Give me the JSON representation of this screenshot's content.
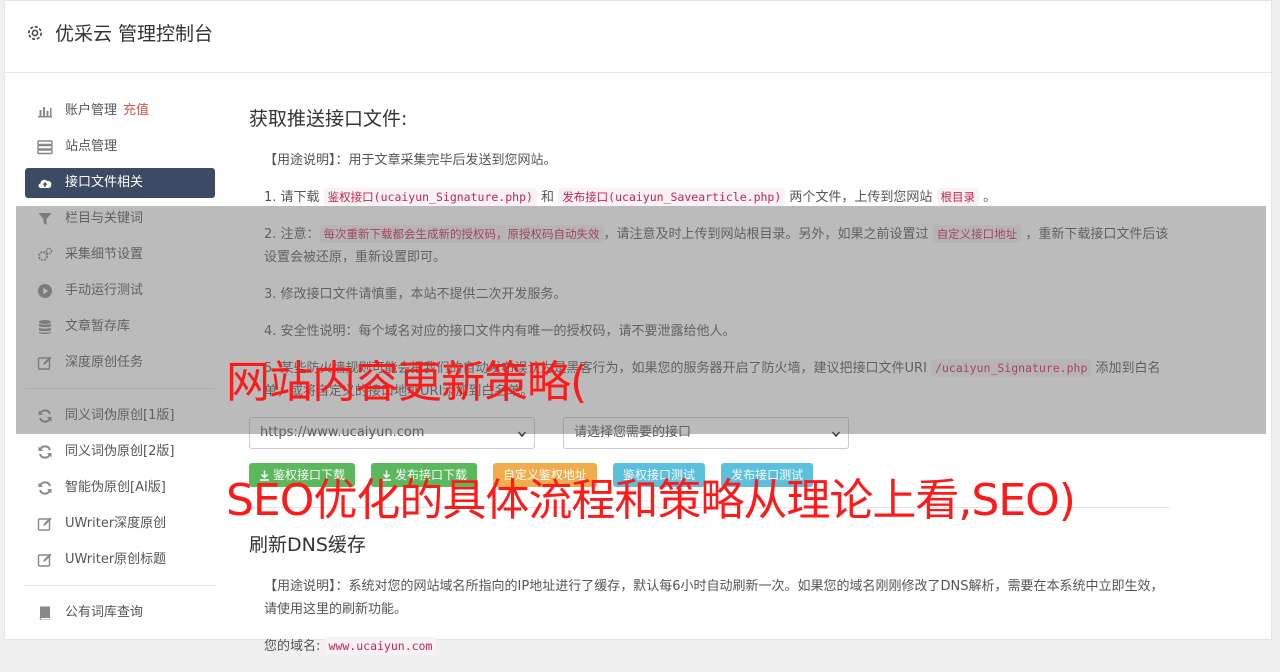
{
  "app": {
    "title": "优采云 管理控制台"
  },
  "sidebar": {
    "items": [
      {
        "label": "账户管理",
        "badge": "充值",
        "icon": "bar-chart-icon"
      },
      {
        "label": "站点管理",
        "icon": "server-icon"
      },
      {
        "label": "接口文件相关",
        "icon": "cloud-upload-icon",
        "active": true
      },
      {
        "label": "栏目与关键词",
        "icon": "filter-icon"
      },
      {
        "label": "采集细节设置",
        "icon": "cogs-icon"
      },
      {
        "label": "手动运行测试",
        "icon": "play-circle-icon"
      },
      {
        "label": "文章暂存库",
        "icon": "database-icon"
      },
      {
        "label": "深度原创任务",
        "icon": "edit-icon"
      }
    ],
    "items2": [
      {
        "label": "同义词伪原创[1版]",
        "icon": "refresh-icon"
      },
      {
        "label": "同义词伪原创[2版]",
        "icon": "refresh-icon"
      },
      {
        "label": "智能伪原创[AI版]",
        "icon": "refresh-icon"
      },
      {
        "label": "UWriter深度原创",
        "icon": "edit-icon"
      },
      {
        "label": "UWriter原创标题",
        "icon": "edit-icon"
      }
    ],
    "items3": [
      {
        "label": "公有词库查询",
        "icon": "book-icon"
      }
    ]
  },
  "section1": {
    "title": "获取推送接口文件:",
    "usage_label": "【用途说明】",
    "usage_text": "：用于文章采集完毕后发送到您网站。",
    "p1_a": "1. 请下载 ",
    "p1_code1": "鉴权接口(ucaiyun_Signature.php)",
    "p1_b": " 和 ",
    "p1_code2": "发布接口(ucaiyun_Savearticle.php)",
    "p1_c": " 两个文件，上传到您网站 ",
    "p1_code3": "根目录",
    "p1_d": " 。",
    "p2_a": "2. 注意：",
    "p2_code1": "每次重新下载都会生成新的授权码，原授权码自动失效",
    "p2_b": "，请注意及时上传到网站根目录。另外，如果之前设置过 ",
    "p2_code2": "自定义接口地址",
    "p2_c": " ，重新下载接口文件后该设置会被还原，重新设置即可。",
    "p3": "3. 修改接口文件请慎重，本站不提供二次开发服务。",
    "p4": "4. 安全性说明：每个域名对应的接口文件内有唯一的授权码，请不要泄露给他人。",
    "p5_a": "5. 某些防火墙规则可能会把我们的自动发布误认为是黑客行为，如果您的服务器开启了防火墙，建议把接口文件URI ",
    "p5_code1": "/ucaiyun_Signature.php",
    "p5_b": " 添加到白名单，",
    "p5_c": "或将自定义的接口地址URI添加到白名单。",
    "site_select": "https://www.ucaiyun.com",
    "api_select": "请选择您需要的接口",
    "buttons": {
      "download_sign": "鉴权接口下载",
      "download_publish": "发布接口下载",
      "custom_sign": "自定义鉴权地址",
      "test_sign": "鉴权接口测试",
      "test_publish": "发布接口测试"
    }
  },
  "section2": {
    "title": "刷新DNS缓存",
    "usage_label": "【用途说明】",
    "usage_text": "：系统对您的网站域名所指向的IP地址进行了缓存，默认每6小时自动刷新一次。如果您的域名刚刚修改了DNS解析，需要在本系统中立即生效，请使用这里的刷新功能。",
    "domain_label": "您的域名:",
    "domain_value": "www.ucaiyun.com"
  },
  "watermark": {
    "line1": "网站内容更新策略(",
    "line2": "SEO优化的具体流程和策略从理论上看,SEO)"
  },
  "colors": {
    "active_nav": "#3d4a63",
    "green": "#5cb85c",
    "orange": "#f0ad4e",
    "blue": "#5bc0de",
    "code": "#c7254e",
    "watermark": "#ff1a1a"
  }
}
